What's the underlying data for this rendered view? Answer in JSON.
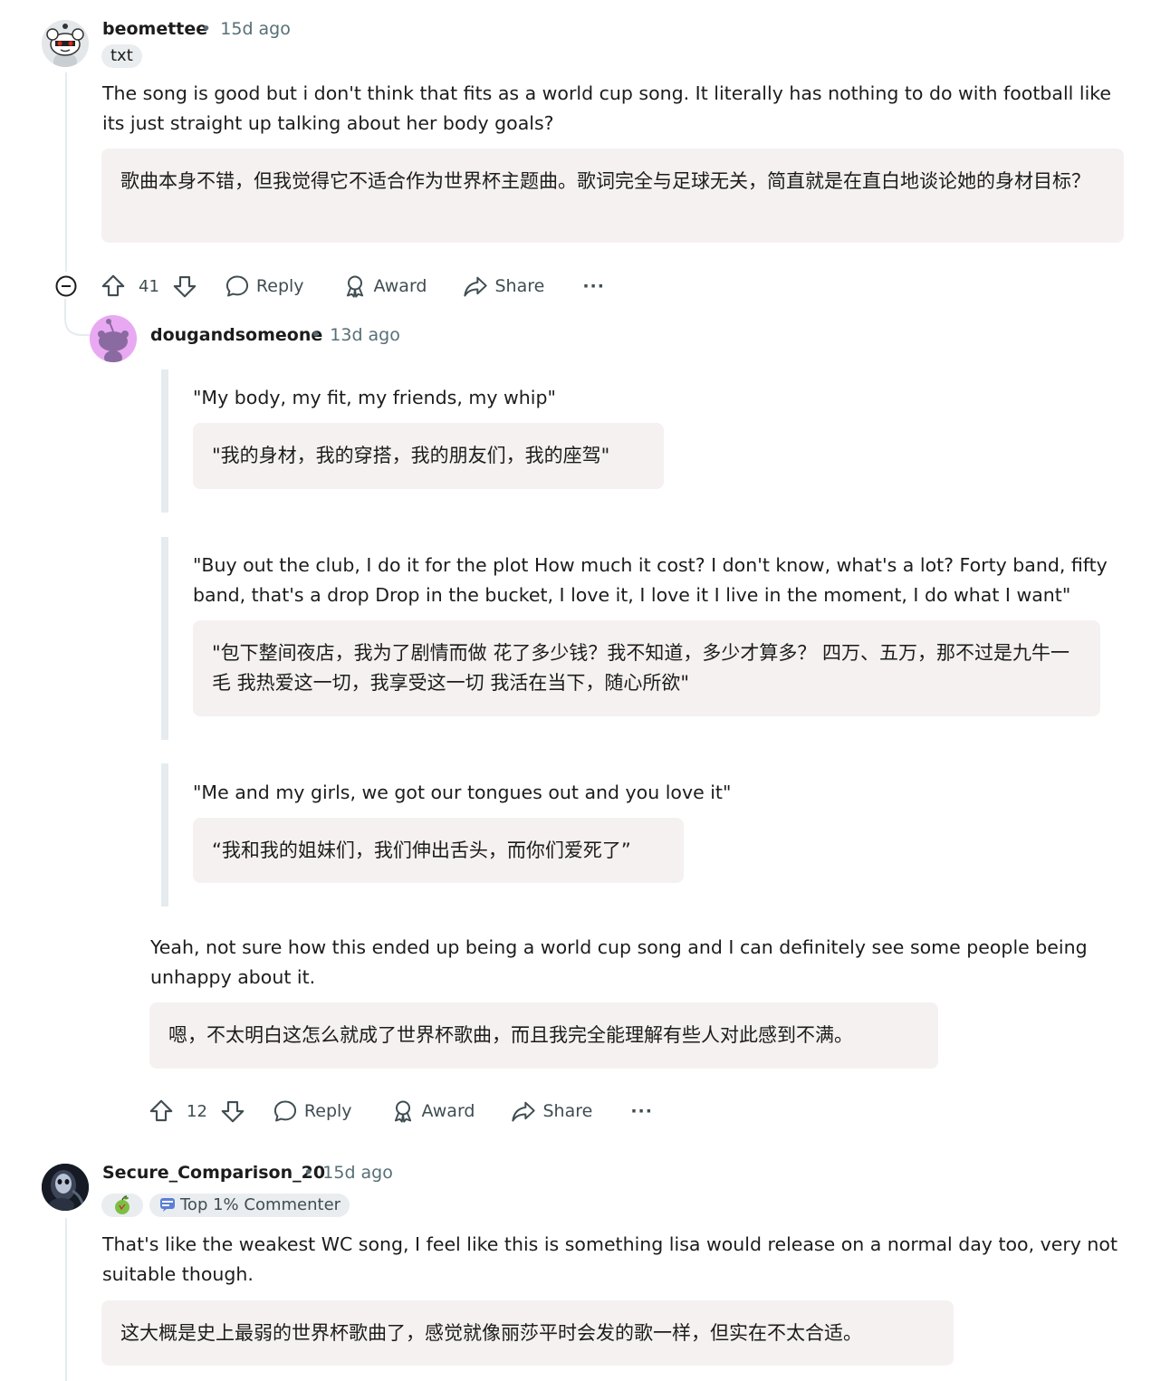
{
  "colors": {
    "page_background": "#ffffff",
    "translation_background": "#f6f1f1",
    "thread_line": "#e5ebee",
    "meta_text": "#576f76",
    "action_text": "#3f4d52"
  },
  "comments": [
    {
      "username": "beomettee",
      "separator": "•",
      "age": "15d ago",
      "flair": "txt",
      "avatar_icon": "snoo-avatar-icon",
      "body": "The song is good but i don't think that fits as a world cup song. It literally has nothing to do with football like its just straight up talking about her body goals?",
      "translation": "歌曲本身不错，但我觉得它不适合作为世界杯主题曲。歌词完全与足球无关，简直就是在直白地谈论她的身材目标？",
      "actions": {
        "votes": "41",
        "reply": "Reply",
        "award": "Award",
        "share": "Share",
        "more": "···"
      }
    },
    {
      "username": "dougandsomeone",
      "separator": "•",
      "age": "13d ago",
      "avatar_icon": "snoo-avatar-icon",
      "quotes": [
        {
          "text": "\"My body, my fit, my friends, my whip\"",
          "translation": "\"我的身材，我的穿搭，我的朋友们，我的座驾\""
        },
        {
          "text": "\"Buy out the club, I do it for the plot How much it cost? I don't know, what's a lot? Forty band, fifty band, that's a drop Drop in the bucket, I love it, I love it I live in the moment, I do what I want\"",
          "translation": "\"包下整间夜店，我为了剧情而做 花了多少钱？我不知道，多少才算多？ 四万、五万，那不过是九牛一毛 我热爱这一切，我享受这一切 我活在当下，随心所欲\""
        },
        {
          "text": "\"Me and my girls, we got our tongues out and you love it\"",
          "translation": "“我和我的姐妹们，我们伸出舌头，而你们爱死了”"
        }
      ],
      "body": "Yeah, not sure how this ended up being a world cup song and I can definitely see some people being unhappy about it.",
      "translation": "嗯，不太明白这怎么就成了世界杯歌曲，而且我完全能理解有些人对此感到不满。",
      "actions": {
        "votes": "12",
        "reply": "Reply",
        "award": "Award",
        "share": "Share",
        "more": "···"
      }
    },
    {
      "username": "Secure_Comparison_20",
      "separator": "•",
      "age": "15d ago",
      "avatar_icon": "user-photo-avatar-icon",
      "flair_emoji_icon": "apple-emoji-icon",
      "flair": "Top 1% Commenter",
      "flair_icon": "commenter-badge-icon",
      "body": "That's like the weakest WC song, I feel like this is something lisa would release on a normal day too, very not suitable though.",
      "translation": "这大概是史上最弱的世界杯歌曲了，感觉就像丽莎平时会发的歌一样，但实在不太合适。"
    }
  ]
}
